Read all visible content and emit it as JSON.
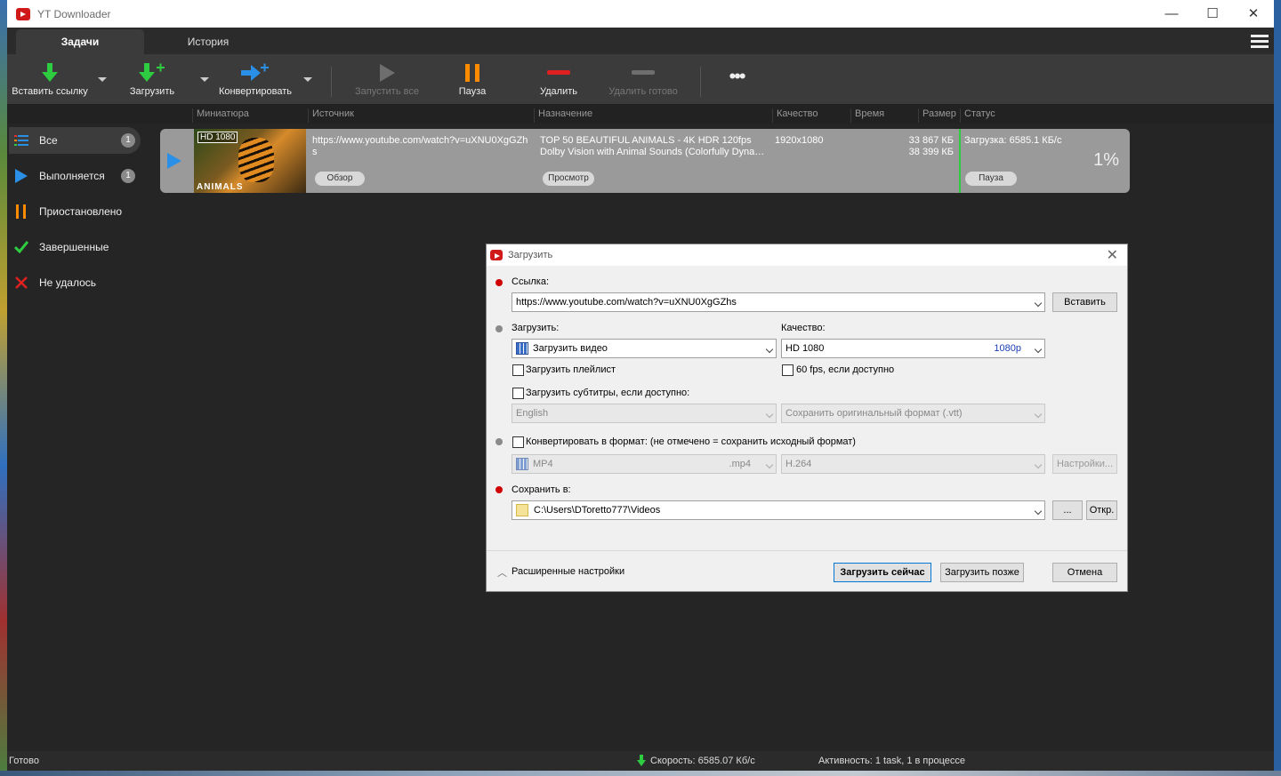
{
  "window": {
    "title": "YT Downloader",
    "minimize": "—",
    "maximize": "☐",
    "close": "✕"
  },
  "tabs": [
    {
      "label": "Задачи"
    },
    {
      "label": "История"
    }
  ],
  "toolbar": {
    "paste_link": "Вставить ссылку",
    "download": "Загрузить",
    "convert": "Конвертировать",
    "start_all": "Запустить все",
    "pause": "Пауза",
    "delete": "Удалить",
    "delete_done": "Удалить готово",
    "more": "•••"
  },
  "columns": [
    "Миниатюра",
    "Источник",
    "Назначение",
    "Качество",
    "Время",
    "Размер",
    "Статус"
  ],
  "sidebar": [
    {
      "label": "Все",
      "count": "1",
      "icon": "list-icon"
    },
    {
      "label": "Выполняется",
      "count": "1",
      "icon": "play-icon"
    },
    {
      "label": "Приостановлено",
      "icon": "pause-icon"
    },
    {
      "label": "Завершенные",
      "icon": "check-icon"
    },
    {
      "label": "Не удалось",
      "icon": "cross-icon"
    }
  ],
  "task": {
    "thumb_badge": "HD 1080",
    "thumb_label": "ANIMALS",
    "source": "https://www.youtube.com/watch?v=uXNU0XgGZh",
    "source_cont": "s",
    "browse": "Обзор",
    "dest_line1": "TOP 50 BEAUTIFUL ANIMALS - 4K HDR 120fps",
    "dest_line2": "Dolby Vision with Animal Sounds (Colorfully Dyna…",
    "preview": "Просмотр",
    "quality": "1920x1080",
    "size1": "33 867 КБ",
    "size2": "38 399 КБ",
    "status": "Загрузка: 6585.1 КБ/с",
    "percent": "1%",
    "progress_fraction": 0.01,
    "pause": "Пауза"
  },
  "statusbar": {
    "ready": "Готово",
    "speed": "Скорость: 6585.07 Кб/с",
    "activity": "Активность: 1 task, 1 в процессе"
  },
  "dialog": {
    "title": "Загрузить",
    "link_label": "Ссылка:",
    "link_value": "https://www.youtube.com/watch?v=uXNU0XgGZhs",
    "paste": "Вставить",
    "download_label": "Загрузить:",
    "download_value": "Загрузить видео",
    "quality_label": "Качество:",
    "quality_value": "HD 1080",
    "quality_tag": "1080p",
    "playlist": "Загрузить плейлист",
    "fps60": "60 fps, если доступно",
    "subtitles": "Загрузить субтитры, если доступно:",
    "sub_lang": "English",
    "sub_format": "Сохранить оригинальный формат (.vtt)",
    "convert": "Конвертировать в формат: (не отмечено = сохранить исходный формат)",
    "format": "MP4",
    "format_ext": ".mp4",
    "codec": "H.264",
    "settings": "Настройки...",
    "save_label": "Сохранить в:",
    "save_path": "C:\\Users\\DToretto777\\Videos",
    "browse": "...",
    "open": "Откр.",
    "advanced": "Расширенные настройки",
    "download_now": "Загрузить сейчас",
    "download_later": "Загрузить позже",
    "cancel": "Отмена"
  },
  "colors": {
    "accent_green": "#2ecc40",
    "accent_blue": "#2a8fe6",
    "accent_orange": "#ff8c00",
    "accent_red": "#e02020",
    "required_dot": "#d00000"
  }
}
